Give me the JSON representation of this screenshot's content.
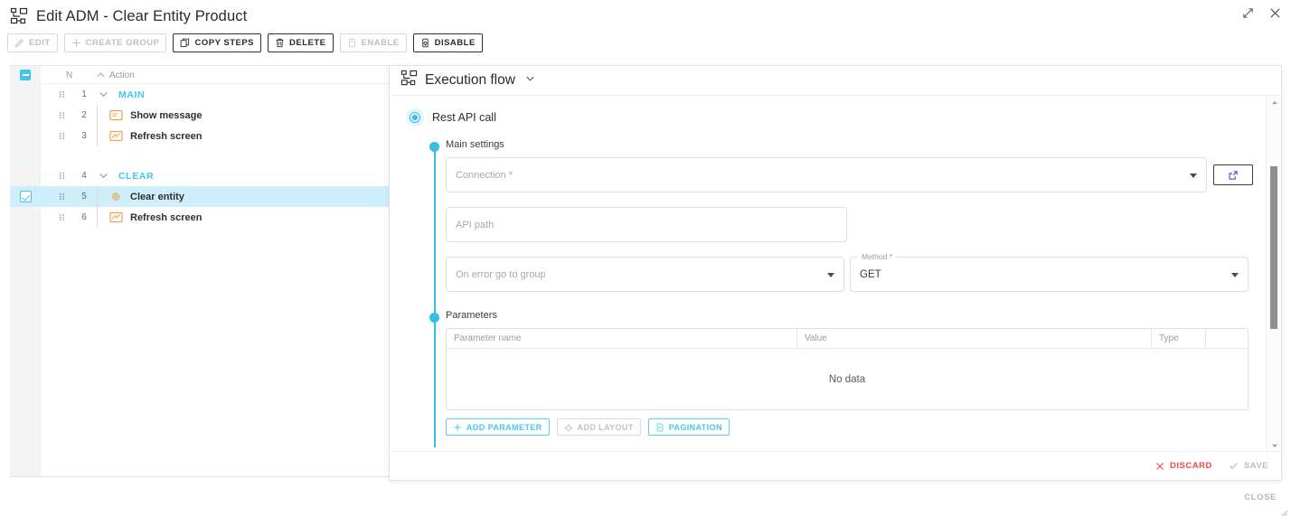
{
  "window": {
    "title": "Edit ADM - Clear Entity Product",
    "title_icon": "flow-diagram-icon",
    "restore_icon": "restore-down-icon",
    "close_icon": "close-icon",
    "close_link": "CLOSE"
  },
  "toolbar": {
    "buttons": [
      {
        "label": "EDIT",
        "icon": "pencil-icon",
        "disabled": true
      },
      {
        "label": "CREATE GROUP",
        "icon": "plus-icon",
        "disabled": true
      },
      {
        "label": "COPY STEPS",
        "icon": "copy-icon",
        "disabled": false
      },
      {
        "label": "DELETE",
        "icon": "trash-icon",
        "disabled": false
      },
      {
        "label": "ENABLE",
        "icon": "enable-icon",
        "disabled": true
      },
      {
        "label": "DISABLE",
        "icon": "disable-icon",
        "disabled": false
      }
    ]
  },
  "steps_table": {
    "columns": {
      "checkbox": "",
      "n": "N",
      "action": "Action"
    },
    "sort_icon": "sort-ascending-icon",
    "header_checkbox_state": "indeterminate",
    "rows": [
      {
        "n": "1",
        "label": "MAIN",
        "type": "group",
        "checked": false,
        "selected": false
      },
      {
        "n": "2",
        "label": "Show message",
        "type": "action",
        "icon": "message-icon",
        "checked": false,
        "selected": false
      },
      {
        "n": "3",
        "label": "Refresh screen",
        "type": "action",
        "icon": "refresh-screen-icon",
        "checked": false,
        "selected": false
      },
      {
        "n": "4",
        "label": "CLEAR",
        "type": "group",
        "checked": false,
        "selected": false
      },
      {
        "n": "5",
        "label": "Clear entity",
        "type": "action",
        "icon": "clear-entity-icon",
        "checked": true,
        "selected": true
      },
      {
        "n": "6",
        "label": "Refresh screen",
        "type": "action",
        "icon": "refresh-screen-icon",
        "checked": false,
        "selected": false
      }
    ]
  },
  "dialog": {
    "header": {
      "title": "Execution flow",
      "icon": "flow-diagram-icon",
      "chevron": "chevron-down-icon"
    },
    "step": {
      "title": "Rest API call",
      "radio_selected": true
    },
    "sections": [
      {
        "id": "main_settings",
        "title": "Main settings"
      },
      {
        "id": "parameters",
        "title": "Parameters"
      }
    ],
    "fields": {
      "connection": {
        "label": "Connection *",
        "value": "",
        "placeholder": "Connection *",
        "type": "select"
      },
      "connection_open": {
        "icon": "external-link-icon"
      },
      "api_path": {
        "label": "API path",
        "value": "",
        "placeholder": "API path",
        "type": "text"
      },
      "on_error_group": {
        "label": "On error go to group",
        "value": "",
        "placeholder": "On error go to group",
        "type": "select"
      },
      "method": {
        "label": "Method *",
        "value": "GET",
        "type": "select",
        "options": [
          "GET"
        ]
      }
    },
    "parameters_table": {
      "columns": [
        "Parameter name",
        "Value",
        "Type",
        ""
      ],
      "rows": [],
      "empty_text": "No data"
    },
    "parameter_buttons": [
      {
        "label": "ADD PARAMETER",
        "icon": "plus-icon",
        "disabled": false
      },
      {
        "label": "ADD LAYOUT",
        "icon": "layout-icon",
        "disabled": true
      },
      {
        "label": "PAGINATION",
        "icon": "document-icon",
        "disabled": false
      }
    ],
    "footer": [
      {
        "label": "DISCARD",
        "icon": "close-icon",
        "style": "danger",
        "disabled": false
      },
      {
        "label": "SAVE",
        "icon": "check-icon",
        "style": "muted",
        "disabled": true
      }
    ]
  },
  "colors": {
    "accent": "#35bdeb",
    "selection": "#cdeefa",
    "danger": "#ea4a4a",
    "action_icon": "#f0a04b"
  }
}
